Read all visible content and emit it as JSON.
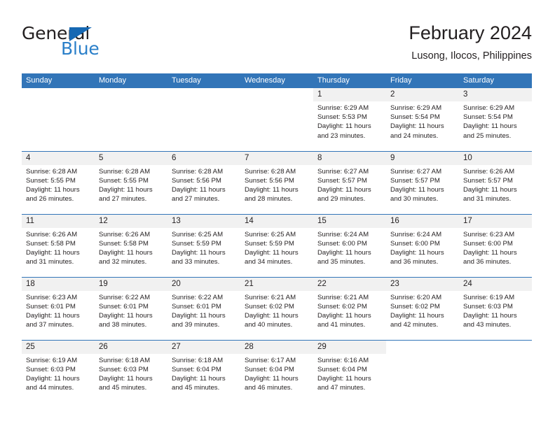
{
  "brand": {
    "name_part1": "General",
    "name_part2": "Blue",
    "triangle_icon": "triangle-icon",
    "color_dark": "#231f20",
    "color_blue": "#2a7fc9"
  },
  "header": {
    "title": "February 2024",
    "subtitle": "Lusong, Ilocos, Philippines"
  },
  "theme": {
    "header_blue": "#3275b8",
    "daynum_band": "#f1f1f1",
    "text": "#231f20"
  },
  "weekday_headers": [
    "Sunday",
    "Monday",
    "Tuesday",
    "Wednesday",
    "Thursday",
    "Friday",
    "Saturday"
  ],
  "weeks": [
    [
      {
        "day": "",
        "sunrise": "",
        "sunset": "",
        "daylight": "",
        "blank": true
      },
      {
        "day": "",
        "sunrise": "",
        "sunset": "",
        "daylight": "",
        "blank": true
      },
      {
        "day": "",
        "sunrise": "",
        "sunset": "",
        "daylight": "",
        "blank": true
      },
      {
        "day": "",
        "sunrise": "",
        "sunset": "",
        "daylight": "",
        "blank": true
      },
      {
        "day": "1",
        "sunrise": "Sunrise: 6:29 AM",
        "sunset": "Sunset: 5:53 PM",
        "daylight": "Daylight: 11 hours and 23 minutes."
      },
      {
        "day": "2",
        "sunrise": "Sunrise: 6:29 AM",
        "sunset": "Sunset: 5:54 PM",
        "daylight": "Daylight: 11 hours and 24 minutes."
      },
      {
        "day": "3",
        "sunrise": "Sunrise: 6:29 AM",
        "sunset": "Sunset: 5:54 PM",
        "daylight": "Daylight: 11 hours and 25 minutes."
      }
    ],
    [
      {
        "day": "4",
        "sunrise": "Sunrise: 6:28 AM",
        "sunset": "Sunset: 5:55 PM",
        "daylight": "Daylight: 11 hours and 26 minutes."
      },
      {
        "day": "5",
        "sunrise": "Sunrise: 6:28 AM",
        "sunset": "Sunset: 5:55 PM",
        "daylight": "Daylight: 11 hours and 27 minutes."
      },
      {
        "day": "6",
        "sunrise": "Sunrise: 6:28 AM",
        "sunset": "Sunset: 5:56 PM",
        "daylight": "Daylight: 11 hours and 27 minutes."
      },
      {
        "day": "7",
        "sunrise": "Sunrise: 6:28 AM",
        "sunset": "Sunset: 5:56 PM",
        "daylight": "Daylight: 11 hours and 28 minutes."
      },
      {
        "day": "8",
        "sunrise": "Sunrise: 6:27 AM",
        "sunset": "Sunset: 5:57 PM",
        "daylight": "Daylight: 11 hours and 29 minutes."
      },
      {
        "day": "9",
        "sunrise": "Sunrise: 6:27 AM",
        "sunset": "Sunset: 5:57 PM",
        "daylight": "Daylight: 11 hours and 30 minutes."
      },
      {
        "day": "10",
        "sunrise": "Sunrise: 6:26 AM",
        "sunset": "Sunset: 5:57 PM",
        "daylight": "Daylight: 11 hours and 31 minutes."
      }
    ],
    [
      {
        "day": "11",
        "sunrise": "Sunrise: 6:26 AM",
        "sunset": "Sunset: 5:58 PM",
        "daylight": "Daylight: 11 hours and 31 minutes."
      },
      {
        "day": "12",
        "sunrise": "Sunrise: 6:26 AM",
        "sunset": "Sunset: 5:58 PM",
        "daylight": "Daylight: 11 hours and 32 minutes."
      },
      {
        "day": "13",
        "sunrise": "Sunrise: 6:25 AM",
        "sunset": "Sunset: 5:59 PM",
        "daylight": "Daylight: 11 hours and 33 minutes."
      },
      {
        "day": "14",
        "sunrise": "Sunrise: 6:25 AM",
        "sunset": "Sunset: 5:59 PM",
        "daylight": "Daylight: 11 hours and 34 minutes."
      },
      {
        "day": "15",
        "sunrise": "Sunrise: 6:24 AM",
        "sunset": "Sunset: 6:00 PM",
        "daylight": "Daylight: 11 hours and 35 minutes."
      },
      {
        "day": "16",
        "sunrise": "Sunrise: 6:24 AM",
        "sunset": "Sunset: 6:00 PM",
        "daylight": "Daylight: 11 hours and 36 minutes."
      },
      {
        "day": "17",
        "sunrise": "Sunrise: 6:23 AM",
        "sunset": "Sunset: 6:00 PM",
        "daylight": "Daylight: 11 hours and 36 minutes."
      }
    ],
    [
      {
        "day": "18",
        "sunrise": "Sunrise: 6:23 AM",
        "sunset": "Sunset: 6:01 PM",
        "daylight": "Daylight: 11 hours and 37 minutes."
      },
      {
        "day": "19",
        "sunrise": "Sunrise: 6:22 AM",
        "sunset": "Sunset: 6:01 PM",
        "daylight": "Daylight: 11 hours and 38 minutes."
      },
      {
        "day": "20",
        "sunrise": "Sunrise: 6:22 AM",
        "sunset": "Sunset: 6:01 PM",
        "daylight": "Daylight: 11 hours and 39 minutes."
      },
      {
        "day": "21",
        "sunrise": "Sunrise: 6:21 AM",
        "sunset": "Sunset: 6:02 PM",
        "daylight": "Daylight: 11 hours and 40 minutes."
      },
      {
        "day": "22",
        "sunrise": "Sunrise: 6:21 AM",
        "sunset": "Sunset: 6:02 PM",
        "daylight": "Daylight: 11 hours and 41 minutes."
      },
      {
        "day": "23",
        "sunrise": "Sunrise: 6:20 AM",
        "sunset": "Sunset: 6:02 PM",
        "daylight": "Daylight: 11 hours and 42 minutes."
      },
      {
        "day": "24",
        "sunrise": "Sunrise: 6:19 AM",
        "sunset": "Sunset: 6:03 PM",
        "daylight": "Daylight: 11 hours and 43 minutes."
      }
    ],
    [
      {
        "day": "25",
        "sunrise": "Sunrise: 6:19 AM",
        "sunset": "Sunset: 6:03 PM",
        "daylight": "Daylight: 11 hours and 44 minutes."
      },
      {
        "day": "26",
        "sunrise": "Sunrise: 6:18 AM",
        "sunset": "Sunset: 6:03 PM",
        "daylight": "Daylight: 11 hours and 45 minutes."
      },
      {
        "day": "27",
        "sunrise": "Sunrise: 6:18 AM",
        "sunset": "Sunset: 6:04 PM",
        "daylight": "Daylight: 11 hours and 45 minutes."
      },
      {
        "day": "28",
        "sunrise": "Sunrise: 6:17 AM",
        "sunset": "Sunset: 6:04 PM",
        "daylight": "Daylight: 11 hours and 46 minutes."
      },
      {
        "day": "29",
        "sunrise": "Sunrise: 6:16 AM",
        "sunset": "Sunset: 6:04 PM",
        "daylight": "Daylight: 11 hours and 47 minutes."
      },
      {
        "day": "",
        "sunrise": "",
        "sunset": "",
        "daylight": "",
        "blank": true
      },
      {
        "day": "",
        "sunrise": "",
        "sunset": "",
        "daylight": "",
        "blank": true
      }
    ]
  ]
}
